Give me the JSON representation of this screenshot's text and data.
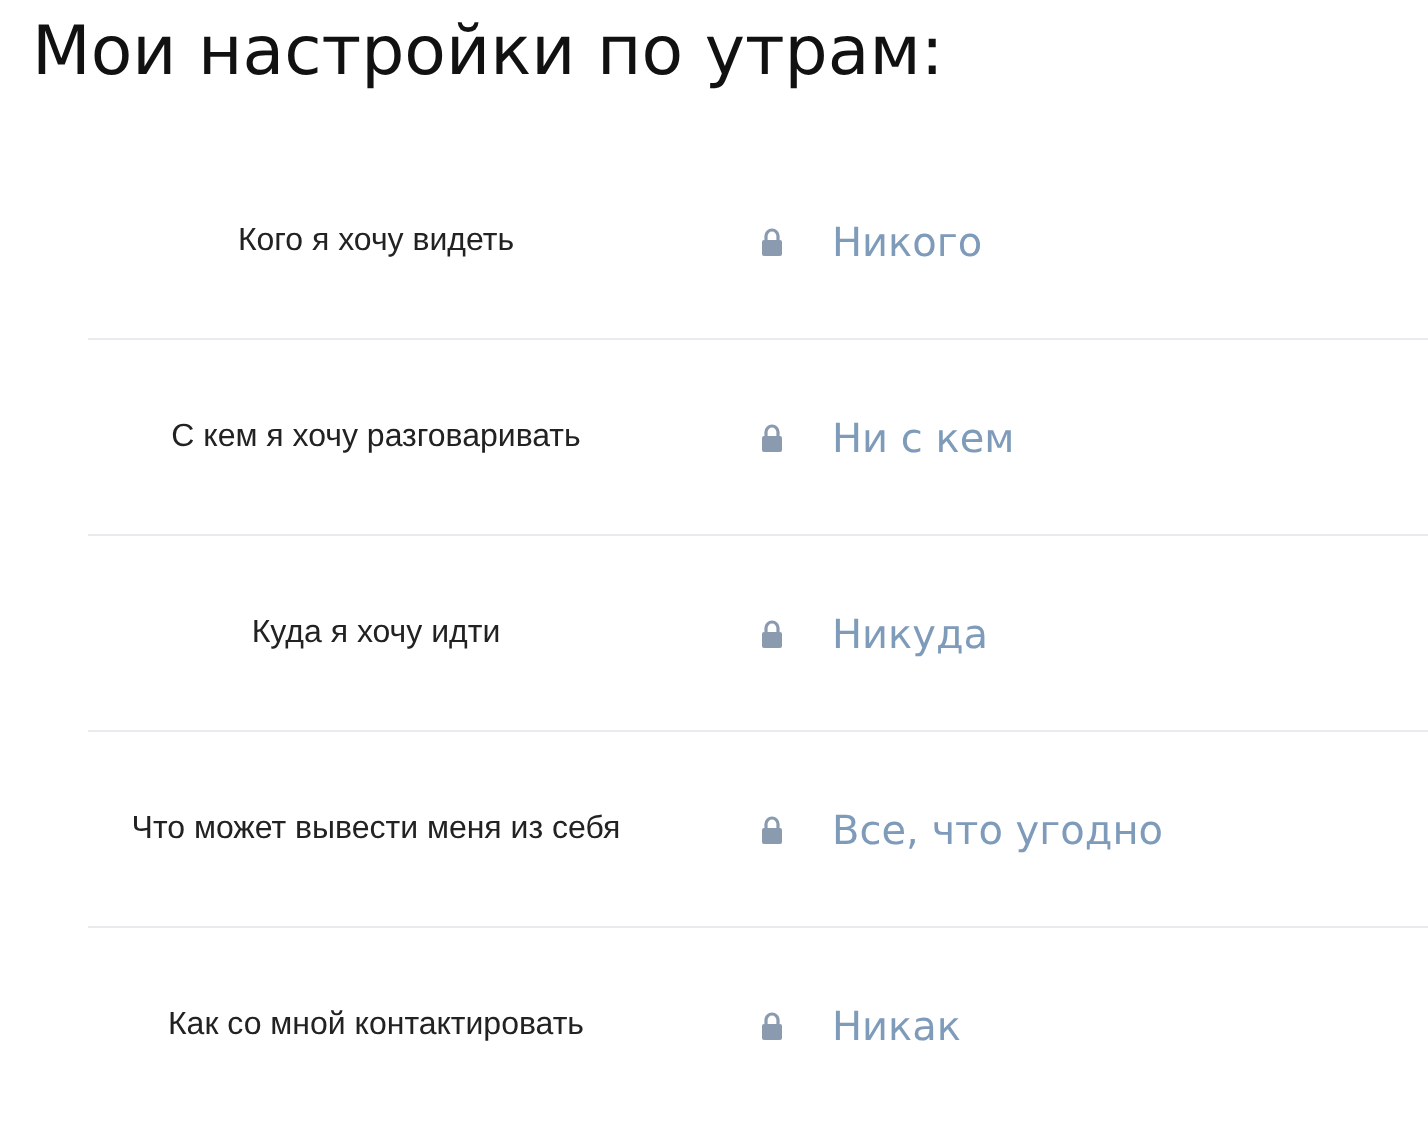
{
  "title": "Мои настройки по утрам:",
  "settings": [
    {
      "label": "Кого я хочу видеть",
      "value": "Никого"
    },
    {
      "label": "С кем я хочу разговаривать",
      "value": "Ни с кем"
    },
    {
      "label": "Куда я хочу идти",
      "value": "Никуда"
    },
    {
      "label": "Что может вывести меня из себя",
      "value": "Все, что угодно"
    },
    {
      "label": "Как со мной контактировать",
      "value": "Никак"
    }
  ]
}
